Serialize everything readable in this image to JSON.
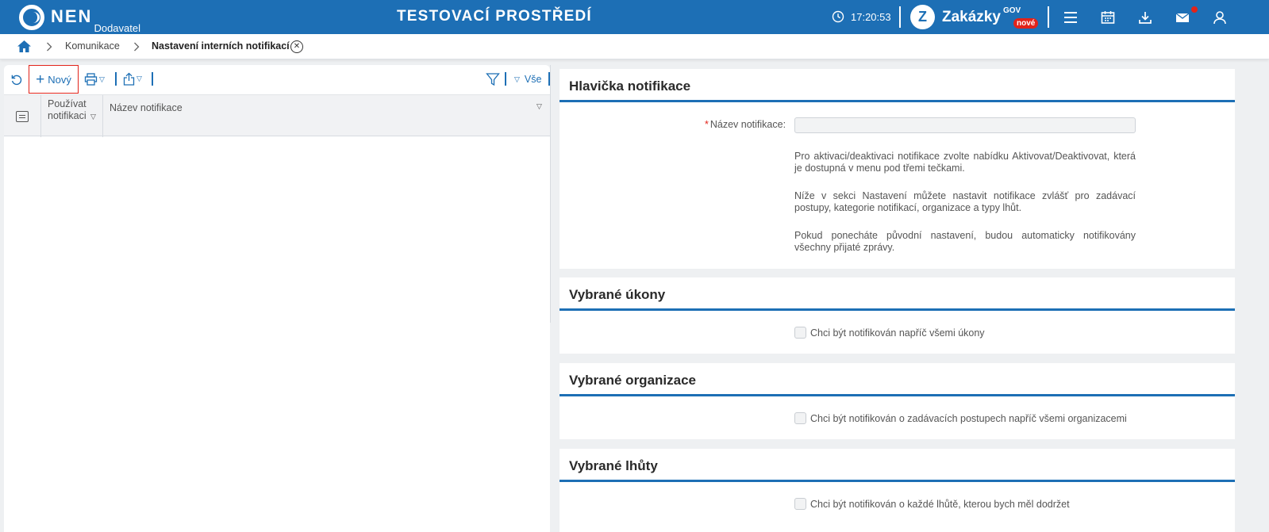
{
  "header": {
    "logo_text": "NEN",
    "logo_sub": "Dodavatel",
    "env_title": "TESTOVACÍ PROSTŘEDÍ",
    "time": "17:20:53",
    "zakazky_label": "Zakázky",
    "zakazky_sup": "GOV",
    "zakazky_badge": "nové"
  },
  "breadcrumb": {
    "items": [
      "Komunikace",
      "Nastavení interních notifikací"
    ]
  },
  "toolbar": {
    "new_label": "Nový",
    "all_label": "Vše"
  },
  "grid": {
    "columns": [
      "Používat notifikaci",
      "Název notifikace"
    ],
    "rows": []
  },
  "sections": {
    "header_section": {
      "title": "Hlavička notifikace",
      "name_label": "Název notifikace:",
      "name_value": "",
      "paragraphs": [
        "Pro aktivaci/deaktivaci notifikace zvolte nabídku Aktivovat/Deaktivovat, která je dostupná v menu pod třemi tečkami.",
        "Níže v sekci Nastavení můžete nastavit notifikace zvlášť pro zadávací postupy, kategorie notifikací, organizace a typy lhůt.",
        "Pokud ponecháte původní nastavení, budou automaticky notifikovány všechny přijaté zprávy."
      ]
    },
    "actions": {
      "title": "Vybrané úkony",
      "checkbox_label": "Chci být notifikován napříč všemi úkony",
      "checked": false
    },
    "organizations": {
      "title": "Vybrané organizace",
      "checkbox_label": "Chci být notifikován o zadávacích postupech napříč všemi organizacemi",
      "checked": false
    },
    "deadlines": {
      "title": "Vybrané lhůty",
      "checkbox_label": "Chci být notifikován o každé lhůtě, kterou bych měl dodržet",
      "checked": false
    }
  },
  "colors": {
    "brand_blue": "#1d6fb5",
    "alert_red": "#e2231a",
    "background": "#eef0f2"
  }
}
